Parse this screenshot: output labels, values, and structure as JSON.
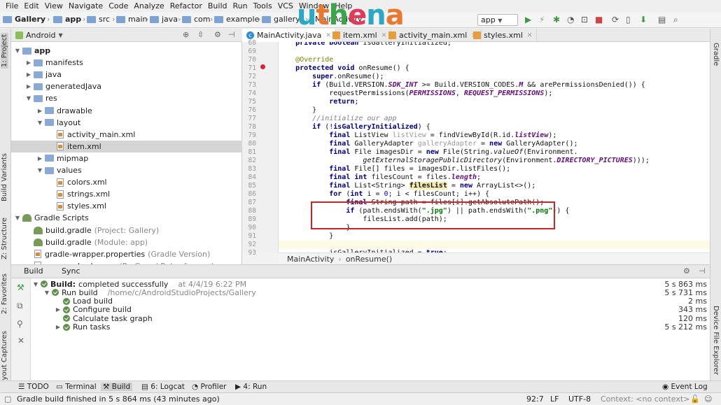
{
  "menu": [
    "File",
    "Edit",
    "View",
    "Navigate",
    "Code",
    "Analyze",
    "Refactor",
    "Build",
    "Run",
    "Tools",
    "VCS",
    "Window",
    "Help"
  ],
  "watermark": {
    "text": "uthena",
    "colors": [
      "#2aa8c4",
      "#e8792e",
      "#3aa64a",
      "#e23a5a",
      "#2aa8c4",
      "#e8792e"
    ]
  },
  "navbar": {
    "crumbs": [
      "Gallery",
      "app",
      "src",
      "main",
      "java",
      "com",
      "example",
      "gallery",
      "MainActivity"
    ],
    "run_config": "app"
  },
  "left_strip": [
    "1: Project",
    "Build Variants",
    "Z: Structure",
    "2: Favorites",
    "Layout Captures"
  ],
  "right_strip": [
    "Gradle",
    "Device File Explorer"
  ],
  "project": {
    "view": "Android",
    "tree": [
      {
        "label": "app",
        "indent": 0,
        "type": "folder",
        "open": true,
        "bold": true
      },
      {
        "label": "manifests",
        "indent": 1,
        "type": "folder"
      },
      {
        "label": "java",
        "indent": 1,
        "type": "folder"
      },
      {
        "label": "generatedJava",
        "indent": 1,
        "type": "folder"
      },
      {
        "label": "res",
        "indent": 1,
        "type": "folder",
        "open": true
      },
      {
        "label": "drawable",
        "indent": 2,
        "type": "folder"
      },
      {
        "label": "layout",
        "indent": 2,
        "type": "folder",
        "open": true
      },
      {
        "label": "activity_main.xml",
        "indent": 3,
        "type": "file"
      },
      {
        "label": "item.xml",
        "indent": 3,
        "type": "file",
        "selected": true
      },
      {
        "label": "mipmap",
        "indent": 2,
        "type": "folder"
      },
      {
        "label": "values",
        "indent": 2,
        "type": "folder",
        "open": true
      },
      {
        "label": "colors.xml",
        "indent": 3,
        "type": "file"
      },
      {
        "label": "strings.xml",
        "indent": 3,
        "type": "file"
      },
      {
        "label": "styles.xml",
        "indent": 3,
        "type": "file"
      },
      {
        "label": "Gradle Scripts",
        "indent": 0,
        "type": "gradle",
        "open": true
      },
      {
        "label": "build.gradle",
        "suffix": "(Project: Gallery)",
        "indent": 1,
        "type": "gradle"
      },
      {
        "label": "build.gradle",
        "suffix": "(Module: app)",
        "indent": 1,
        "type": "gradle"
      },
      {
        "label": "gradle-wrapper.properties",
        "suffix": "(Gradle Version)",
        "indent": 1,
        "type": "file"
      },
      {
        "label": "proguard-rules.pro",
        "suffix": "(ProGuard Rules for app)",
        "indent": 1,
        "type": "file"
      }
    ]
  },
  "editor": {
    "tabs": [
      {
        "label": "MainActivity.java",
        "icon": "class",
        "active": true
      },
      {
        "label": "item.xml",
        "icon": "xml"
      },
      {
        "label": "activity_main.xml",
        "icon": "xml"
      },
      {
        "label": "styles.xml",
        "icon": "xml"
      }
    ],
    "line_numbers": [
      "68",
      "69",
      "70",
      "71",
      "72",
      "73",
      "74",
      "75",
      "76",
      "77",
      "78",
      "79",
      "80",
      "81",
      "82",
      "83",
      "84",
      "85",
      "86",
      "87",
      "88",
      "89",
      "90",
      "91",
      "92",
      "93"
    ],
    "breadcrumb": [
      "MainActivity",
      "onResume()"
    ]
  },
  "build": {
    "tabs": [
      "Build",
      "Sync"
    ],
    "rows": [
      {
        "label": "Build:",
        "label2": "completed successfully",
        "extra": "at 4/4/19 6:22 PM",
        "duration": "5 s 863 ms",
        "indent": 0
      },
      {
        "label": "Run build",
        "extra": "/home/c/AndroidStudioProjects/Gallery",
        "duration": "5 s 731 ms",
        "indent": 1
      },
      {
        "label": "Load build",
        "extra": "",
        "duration": "2 ms",
        "indent": 2
      },
      {
        "label": "Configure build",
        "extra": "",
        "duration": "343 ms",
        "indent": 2
      },
      {
        "label": "Calculate task graph",
        "extra": "",
        "duration": "120 ms",
        "indent": 2
      },
      {
        "label": "Run tasks",
        "extra": "",
        "duration": "5 s 212 ms",
        "indent": 2
      }
    ]
  },
  "bottom_tabs": [
    "TODO",
    "Terminal",
    "Build",
    "6: Logcat",
    "Profiler",
    "4: Run",
    "Event Log"
  ],
  "status": {
    "message": "Gradle build finished in 5 s 864 ms (43 minutes ago)",
    "position": "92:7",
    "line_sep": "LF",
    "encoding": "UTF-8",
    "context": "Context: <no context>"
  }
}
